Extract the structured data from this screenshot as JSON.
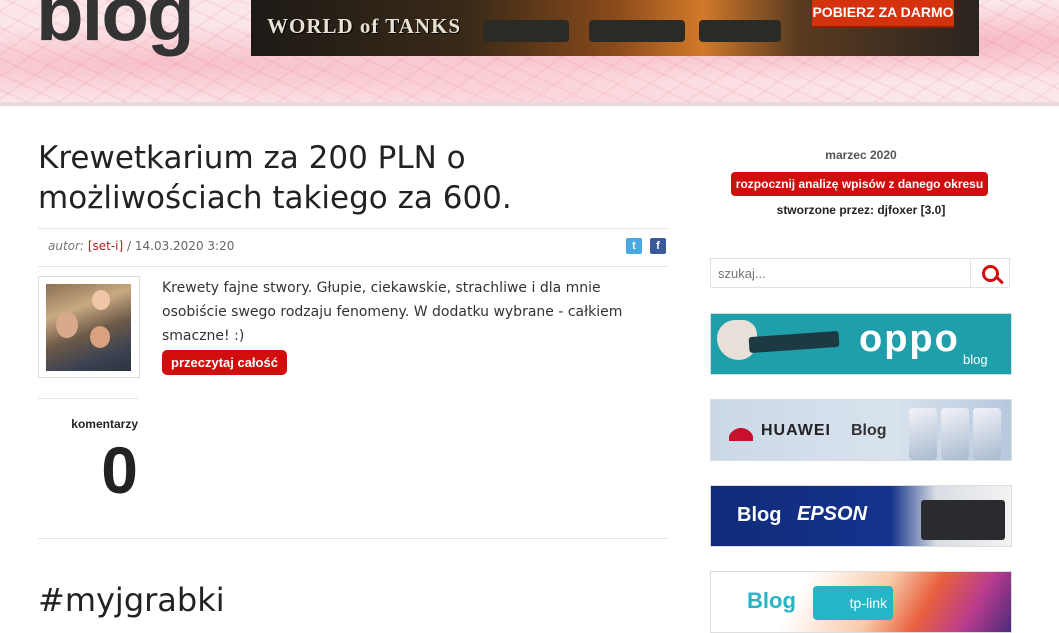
{
  "header": {
    "logo_text": "blog",
    "banner": {
      "brand": "WORLD of TANKS",
      "cta_label": "POBIERZ ZA DARMO"
    }
  },
  "post": {
    "title": "Krewetkarium za 200 PLN o możliwościach takiego za 600.",
    "author_prefix": "autor:",
    "author": "[set-i]",
    "date": "/ 14.03.2020 3:20",
    "excerpt": "Krewety fajne stwory. Głupie, ciekawskie, strachliwe i dla mnie osobiście swego rodzaju fenomeny. W dodatku wybrane - całkiem smaczne! :)",
    "read_more_label": "przeczytaj całość",
    "comments_label": "komentarzy",
    "comments_count": "0"
  },
  "next_post": {
    "title": "#myjgrabki"
  },
  "sidebar": {
    "month": "marzec 2020",
    "analyze_label": "rozpocznij analizę wpisów z danego okresu",
    "created_by": "stworzone przez: djfoxer [3.0]",
    "search": {
      "placeholder": "szukaj..."
    },
    "ads": [
      {
        "brand": "oppo",
        "label": "blog"
      },
      {
        "brand": "HUAWEI",
        "label": "Blog"
      },
      {
        "brand": "EPSON",
        "label": "Blog"
      },
      {
        "brand": "tp-link",
        "label": "Blog"
      }
    ]
  },
  "colors": {
    "accent": "#d10d0d",
    "author_link": "#b51c1c",
    "twitter": "#4aa8e0",
    "facebook": "#3b5a98"
  }
}
